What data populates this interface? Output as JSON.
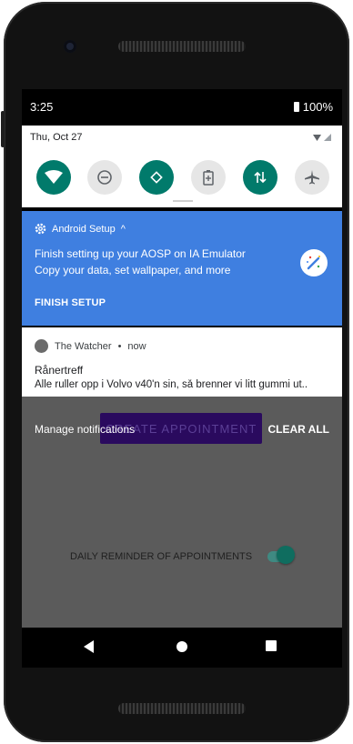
{
  "status_bar": {
    "time": "3:25",
    "battery": "100%"
  },
  "quick_settings": {
    "date": "Thu, Oct 27",
    "tiles": [
      {
        "icon": "wifi-icon",
        "state": "on"
      },
      {
        "icon": "do-not-disturb-icon",
        "state": "off"
      },
      {
        "icon": "auto-rotate-icon",
        "state": "on"
      },
      {
        "icon": "battery-saver-icon",
        "state": "off"
      },
      {
        "icon": "mobile-data-icon",
        "state": "on"
      },
      {
        "icon": "airplane-mode-icon",
        "state": "off"
      }
    ]
  },
  "notifications": {
    "setup": {
      "app": "Android Setup",
      "title": "Finish setting up your AOSP on IA Emulator",
      "text": "Copy your data, set wallpaper, and more",
      "action": "FINISH SETUP",
      "color": "#3f7fe0"
    },
    "watcher": {
      "app": "The Watcher",
      "time": "now",
      "title": "Rånertreff",
      "text": "Alle ruller opp i Volvo v40'n sin, så brenner vi litt gummi ut.."
    }
  },
  "shade_footer": {
    "manage": "Manage notifications",
    "clear_all": "CLEAR ALL"
  },
  "app": {
    "create_button": "CREATE APPOINTMENT",
    "reminder_label": "DAILY REMINDER OF APPOINTMENTS",
    "reminder_on": true,
    "accent": "#017a6b"
  },
  "nav": [
    "back-icon",
    "home-icon",
    "recents-icon"
  ]
}
